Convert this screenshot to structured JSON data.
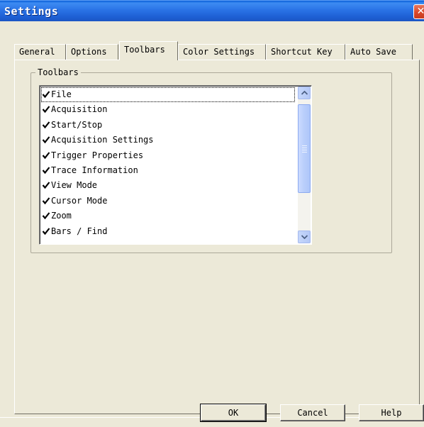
{
  "window": {
    "title": "Settings",
    "close_glyph": "✕"
  },
  "tabs": [
    {
      "label": "General"
    },
    {
      "label": "Options"
    },
    {
      "label": "Toolbars",
      "active": true
    },
    {
      "label": "Color Settings"
    },
    {
      "label": "Shortcut Key"
    },
    {
      "label": "Auto Save"
    }
  ],
  "group": {
    "label": "Toolbars"
  },
  "toolbars_list": {
    "items": [
      {
        "label": "File",
        "checked": true,
        "focused": true
      },
      {
        "label": "Acquisition",
        "checked": true
      },
      {
        "label": "Start/Stop",
        "checked": true
      },
      {
        "label": "Acquisition Settings",
        "checked": true
      },
      {
        "label": "Trigger Properties",
        "checked": true
      },
      {
        "label": "Trace Information",
        "checked": true
      },
      {
        "label": "View Mode",
        "checked": true
      },
      {
        "label": "Cursor Mode",
        "checked": true
      },
      {
        "label": "Zoom",
        "checked": true
      },
      {
        "label": "Bars / Find",
        "checked": true
      }
    ]
  },
  "buttons": {
    "ok": "OK",
    "cancel": "Cancel",
    "help": "Help"
  },
  "icons": {
    "checkmark": "checkmark-icon",
    "scroll_up": "chevron-up-icon",
    "scroll_down": "chevron-down-icon",
    "close": "close-icon"
  },
  "colors": {
    "titlebar": "#1d5fd3",
    "close_button": "#d9482b",
    "dialog_bg": "#ece9d8"
  }
}
